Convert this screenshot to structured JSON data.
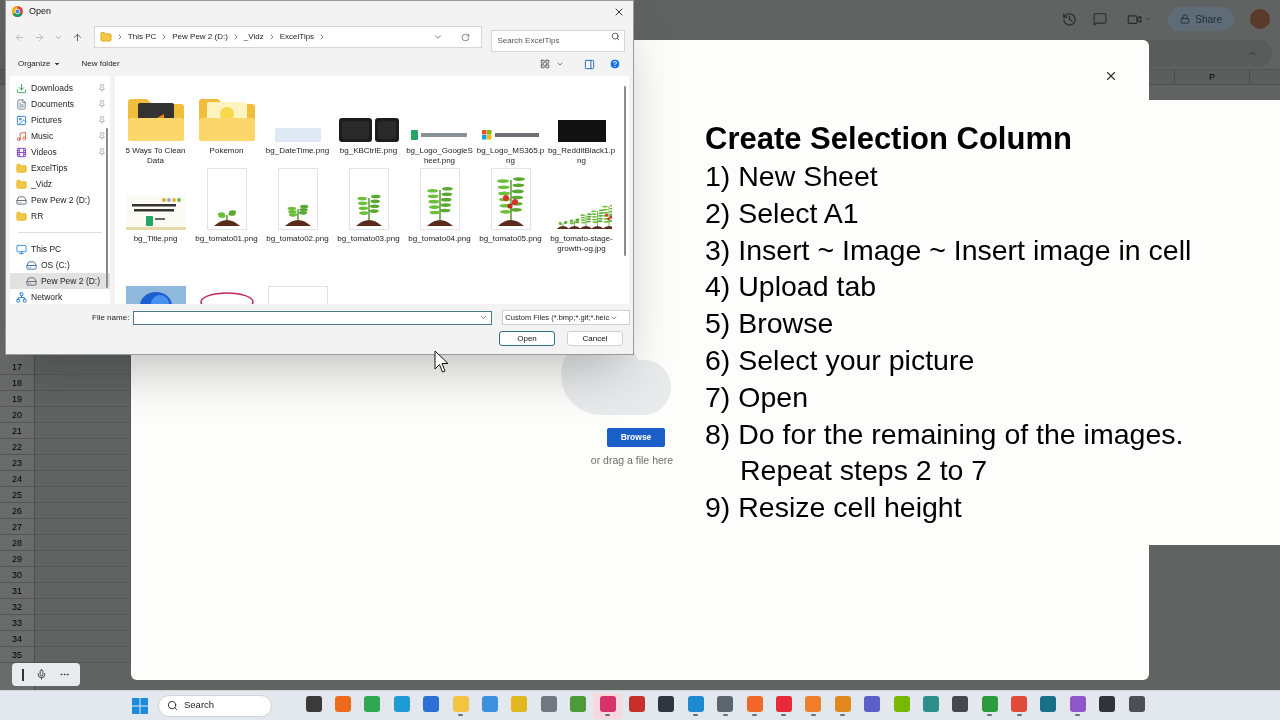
{
  "sheet": {
    "column_header": "P",
    "share_button": "Share",
    "row_numbers": [
      "17",
      "18",
      "19",
      "20",
      "21",
      "22",
      "23",
      "24",
      "25",
      "26",
      "27",
      "28",
      "29",
      "30",
      "31",
      "32",
      "33",
      "34",
      "35"
    ]
  },
  "upload_modal": {
    "browse_button": "Browse",
    "drag_hint": "or drag a file here"
  },
  "instructions": {
    "title": "Create Selection Column",
    "steps": [
      {
        "kind": "step",
        "text": "1) New Sheet"
      },
      {
        "kind": "step",
        "text": "2) Select A1"
      },
      {
        "kind": "step",
        "text": "3) Insert ~ Image ~ Insert image in cell"
      },
      {
        "kind": "step",
        "text": "4) Upload tab"
      },
      {
        "kind": "step",
        "text": "5) Browse"
      },
      {
        "kind": "step",
        "text": "6) Select your picture"
      },
      {
        "kind": "step",
        "text": "7) Open"
      },
      {
        "kind": "step",
        "text": "8) Do for the remaining of the images."
      },
      {
        "kind": "continuation",
        "text": "Repeat steps 2 to 7"
      },
      {
        "kind": "step",
        "text": "9) Resize cell height"
      }
    ]
  },
  "open_dialog": {
    "title": "Open",
    "breadcrumb": [
      "This PC",
      "Pew Pew 2 (D:)",
      "_Vidz",
      "ExcelTips"
    ],
    "search_placeholder": "Search ExcelTips",
    "organize": "Organize",
    "new_folder": "New folder",
    "nav": [
      {
        "label": "Downloads",
        "kind": "downloads",
        "pinned": true,
        "selected": false
      },
      {
        "label": "Documents",
        "kind": "documents",
        "pinned": true,
        "selected": false
      },
      {
        "label": "Pictures",
        "kind": "pictures",
        "pinned": true,
        "selected": false
      },
      {
        "label": "Music",
        "kind": "music",
        "pinned": true,
        "selected": false
      },
      {
        "label": "Videos",
        "kind": "videos",
        "pinned": true,
        "selected": false
      },
      {
        "label": "ExcelTips",
        "kind": "folder",
        "pinned": false,
        "selected": false
      },
      {
        "label": "_Vidz",
        "kind": "folder",
        "pinned": false,
        "selected": false
      },
      {
        "label": "Pew Pew 2 (D:)",
        "kind": "drive",
        "pinned": false,
        "selected": false
      },
      {
        "label": "RR",
        "kind": "folder",
        "pinned": false,
        "selected": false
      },
      {
        "kind": "divider"
      },
      {
        "label": "This PC",
        "kind": "pc",
        "pinned": false,
        "selected": false,
        "children": [
          {
            "label": "OS (C:)",
            "kind": "os-drive",
            "pinned": false,
            "selected": false
          },
          {
            "label": "Pew Pew 2 (D:)",
            "kind": "drive",
            "pinned": false,
            "selected": true
          }
        ]
      },
      {
        "label": "Network",
        "kind": "network",
        "pinned": false,
        "selected": false
      }
    ],
    "files": [
      {
        "name": "5 Ways To Clean Data",
        "kind": "folder-dark"
      },
      {
        "name": "Pokemon",
        "kind": "folder-light"
      },
      {
        "name": "bg_DateTime.png",
        "kind": "strip"
      },
      {
        "name": "bg_KBCtrlE.png",
        "kind": "keys"
      },
      {
        "name": "bg_Logo_GoogleSheet.png",
        "kind": "logo-sheets"
      },
      {
        "name": "bg_Logo_MS365.png",
        "kind": "logo-ms"
      },
      {
        "name": "bg_RedditBlack1.png",
        "kind": "black"
      },
      {
        "name": "bg_Title.png",
        "kind": "card"
      },
      {
        "name": "bg_tomato01.png",
        "kind": "sprout"
      },
      {
        "name": "bg_tomato02.png",
        "kind": "seedling"
      },
      {
        "name": "bg_tomato03.png",
        "kind": "plant-small"
      },
      {
        "name": "bg_tomato04.png",
        "kind": "plant-medium"
      },
      {
        "name": "bg_tomato05.png",
        "kind": "plant-fruit"
      },
      {
        "name": "bg_tomato-stage-growth-og.jpg",
        "kind": "plant-series"
      },
      {
        "kind": "photo-blue"
      },
      {
        "kind": "sketch-red"
      },
      {
        "kind": "blank"
      }
    ],
    "file_name_label": "File name:",
    "file_type": "Custom Files (*.bmp;*.gif;*.heic",
    "open_button": "Open",
    "cancel_button": "Cancel"
  },
  "taskbar": {
    "search": "Search",
    "apps": [
      {
        "color": "#3a3a3a",
        "open": false,
        "selected": false
      },
      {
        "color": "#f06a1d",
        "open": false,
        "selected": false
      },
      {
        "color": "#2fa84f",
        "open": false,
        "selected": false
      },
      {
        "color": "#1e9bd7",
        "open": false,
        "selected": false
      },
      {
        "color": "#2b6fd6",
        "open": false,
        "selected": false
      },
      {
        "color": "#f5c342",
        "open": true,
        "selected": false
      },
      {
        "color": "#3d8fe0",
        "open": false,
        "selected": false
      },
      {
        "color": "#e3b81f",
        "open": false,
        "selected": false
      },
      {
        "color": "#6f7780",
        "open": false,
        "selected": false
      },
      {
        "color": "#4c9a3a",
        "open": false,
        "selected": false
      },
      {
        "color": "#d6336c",
        "open": true,
        "selected": true
      },
      {
        "color": "#c9302c",
        "open": false,
        "selected": false
      },
      {
        "color": "#2d3540",
        "open": false,
        "selected": false
      },
      {
        "color": "#1f8ad2",
        "open": true,
        "selected": false
      },
      {
        "color": "#5b6570",
        "open": true,
        "selected": false
      },
      {
        "color": "#f2672a",
        "open": true,
        "selected": false
      },
      {
        "color": "#e8283b",
        "open": true,
        "selected": false
      },
      {
        "color": "#f07f2d",
        "open": true,
        "selected": false
      },
      {
        "color": "#e08a1e",
        "open": true,
        "selected": false
      },
      {
        "color": "#5b5fc7",
        "open": false,
        "selected": false
      },
      {
        "color": "#76b900",
        "open": false,
        "selected": false
      },
      {
        "color": "#2e8f8a",
        "open": false,
        "selected": false
      },
      {
        "color": "#44484d",
        "open": false,
        "selected": false
      },
      {
        "color": "#2c9a3f",
        "open": true,
        "selected": false
      },
      {
        "color": "#e04a3a",
        "open": true,
        "selected": false
      },
      {
        "color": "#1c6f88",
        "open": false,
        "selected": false
      },
      {
        "color": "#8e56c8",
        "open": true,
        "selected": false
      },
      {
        "color": "#30343a",
        "open": false,
        "selected": false
      },
      {
        "color": "#4d4f52",
        "open": false,
        "selected": false
      }
    ]
  }
}
